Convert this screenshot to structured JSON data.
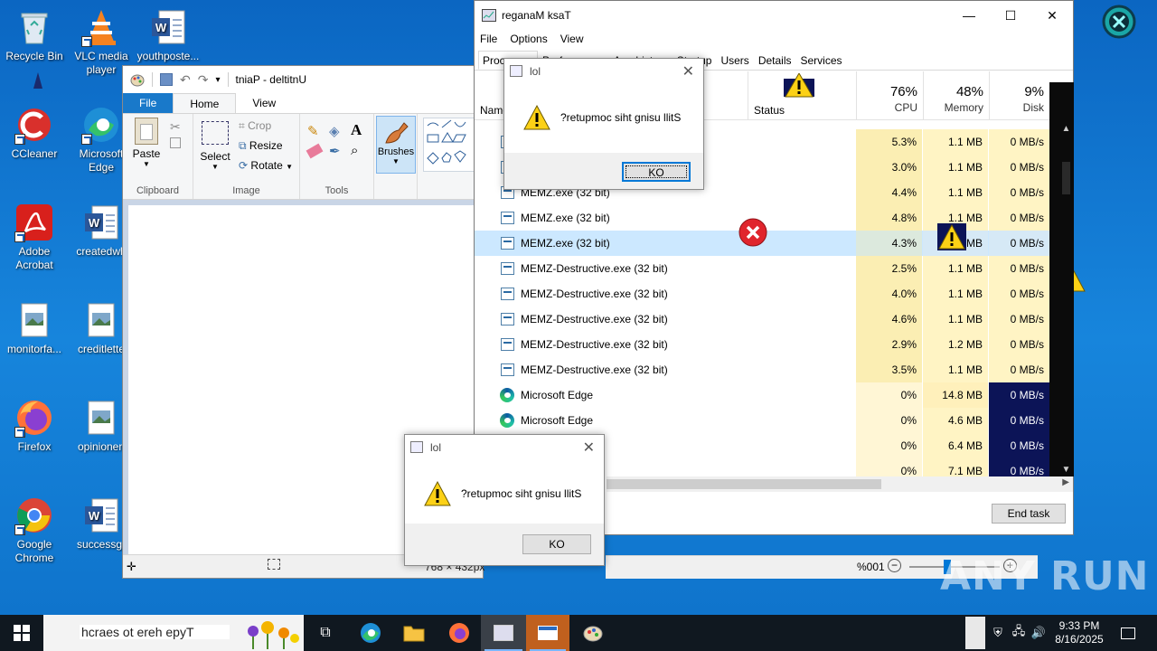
{
  "desktop": {
    "icons": [
      {
        "label": "Recycle Bin",
        "icon": "recycle-bin-icon"
      },
      {
        "label": "VLC media player",
        "icon": "vlc-icon"
      },
      {
        "label": "youthposte...",
        "icon": "word-doc-icon"
      },
      {
        "label": "CCleaner",
        "icon": "ccleaner-icon"
      },
      {
        "label": "Microsoft Edge",
        "icon": "edge-icon"
      },
      {
        "label": "Adobe Acrobat",
        "icon": "acrobat-icon"
      },
      {
        "label": "createdwh",
        "icon": "word-doc-icon"
      },
      {
        "label": "monitorfa...",
        "icon": "image-file-icon"
      },
      {
        "label": "creditlette",
        "icon": "image-file-icon"
      },
      {
        "label": "Firefox",
        "icon": "firefox-icon"
      },
      {
        "label": "opinionen",
        "icon": "image-file-icon"
      },
      {
        "label": "Google Chrome",
        "icon": "chrome-icon"
      },
      {
        "label": "successgr",
        "icon": "word-doc-icon"
      }
    ]
  },
  "paint": {
    "title": "tniaP - deltitnU",
    "tabs": {
      "file": "File",
      "home": "Home",
      "view": "View"
    },
    "clipboard": {
      "paste": "Paste",
      "group": "Clipboard"
    },
    "image": {
      "select": "Select",
      "crop": "Crop",
      "resize": "Resize",
      "rotate": "Rotate",
      "group": "Image"
    },
    "tools": {
      "group": "Tools"
    },
    "brushes": "Brushes",
    "status": {
      "size": "768 × 432px",
      "zoom": "%001"
    }
  },
  "taskmanager": {
    "title": "reganaM ksaT",
    "menu": [
      "File",
      "Options",
      "View"
    ],
    "tabs": [
      "Processes",
      "Performance",
      "App history",
      "Startup",
      "Users",
      "Details",
      "Services"
    ],
    "columns": {
      "name": "Name",
      "status": "Status",
      "cpu_pct": "76%",
      "cpu": "CPU",
      "mem_pct": "48%",
      "mem": "Memory",
      "disk_pct": "9%",
      "disk": "Disk"
    },
    "rows": [
      {
        "name": "",
        "cpu": "5.3%",
        "mem": "1.1 MB",
        "disk": "0 MB/s"
      },
      {
        "name": "",
        "cpu": "3.0%",
        "mem": "1.1 MB",
        "disk": "0 MB/s"
      },
      {
        "name": "MEMZ.exe (32 bit)",
        "cpu": "4.4%",
        "mem": "1.1 MB",
        "disk": "0 MB/s"
      },
      {
        "name": "MEMZ.exe (32 bit)",
        "cpu": "4.8%",
        "mem": "1.1 MB",
        "disk": "0 MB/s"
      },
      {
        "name": "MEMZ.exe (32 bit)",
        "cpu": "4.3%",
        "mem": "MB",
        "disk": "0 MB/s"
      },
      {
        "name": "MEMZ-Destructive.exe (32 bit)",
        "cpu": "2.5%",
        "mem": "1.1 MB",
        "disk": "0 MB/s"
      },
      {
        "name": "MEMZ-Destructive.exe (32 bit)",
        "cpu": "4.0%",
        "mem": "1.1 MB",
        "disk": "0 MB/s"
      },
      {
        "name": "MEMZ-Destructive.exe (32 bit)",
        "cpu": "4.6%",
        "mem": "1.1 MB",
        "disk": "0 MB/s"
      },
      {
        "name": "MEMZ-Destructive.exe (32 bit)",
        "cpu": "2.9%",
        "mem": "1.2 MB",
        "disk": "0 MB/s"
      },
      {
        "name": "MEMZ-Destructive.exe (32 bit)",
        "cpu": "3.5%",
        "mem": "1.1 MB",
        "disk": "0 MB/s"
      },
      {
        "name": "Microsoft Edge",
        "cpu": "0%",
        "mem": "14.8 MB",
        "disk": "0 MB/s"
      },
      {
        "name": "Microsoft Edge",
        "cpu": "0%",
        "mem": "4.6 MB",
        "disk": "0 MB/s"
      },
      {
        "name": "",
        "cpu": "0%",
        "mem": "6.4 MB",
        "disk": "0 MB/s"
      },
      {
        "name": "",
        "cpu": "0%",
        "mem": "7.1 MB",
        "disk": "0 MB/s"
      }
    ],
    "end_task": "End task"
  },
  "dialog1": {
    "title": "lol",
    "message": "?retupmoc siht gnisu llitS",
    "ok": "KO"
  },
  "dialog2": {
    "title": "lol",
    "message": "?retupmoc siht gnisu llitS",
    "ok": "KO"
  },
  "taskbar": {
    "search_placeholder": "hcraes ot ereh epyT",
    "time": "9:33 PM",
    "date": "8/16/2025"
  },
  "watermark": "ANY RUN",
  "colors": {
    "cpu_hot": "#fdf3c1",
    "cpu_warm": "#fff6d5",
    "disk_dark": "#0c1457",
    "accent": "#0078d7"
  }
}
